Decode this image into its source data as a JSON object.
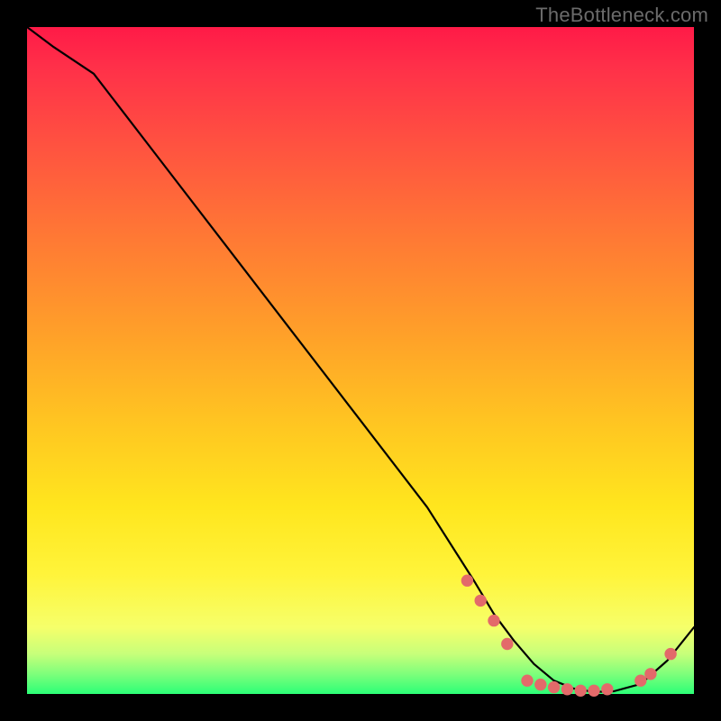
{
  "watermark": "TheBottleneck.com",
  "chart_data": {
    "type": "line",
    "title": "",
    "xlabel": "",
    "ylabel": "",
    "xlim": [
      0,
      100
    ],
    "ylim": [
      0,
      100
    ],
    "grid": false,
    "legend": false,
    "series": [
      {
        "name": "curve",
        "x": [
          0,
          4,
          10,
          20,
          30,
          40,
          50,
          60,
          67,
          70,
          73,
          76,
          79,
          82,
          85,
          88,
          92,
          96,
          100
        ],
        "y": [
          100,
          97,
          93,
          80,
          67,
          54,
          41,
          28,
          17,
          12,
          8,
          4.5,
          2,
          0.8,
          0.3,
          0.4,
          1.5,
          5,
          10
        ],
        "color": "#000000"
      }
    ],
    "markers": {
      "name": "highlight-points",
      "color": "#e36a6a",
      "radius_frac": 0.009,
      "points": [
        {
          "x": 66,
          "y": 17
        },
        {
          "x": 68,
          "y": 14
        },
        {
          "x": 70,
          "y": 11
        },
        {
          "x": 72,
          "y": 7.5
        },
        {
          "x": 75,
          "y": 2.0
        },
        {
          "x": 77,
          "y": 1.4
        },
        {
          "x": 79,
          "y": 1.0
        },
        {
          "x": 81,
          "y": 0.7
        },
        {
          "x": 83,
          "y": 0.5
        },
        {
          "x": 85,
          "y": 0.5
        },
        {
          "x": 87,
          "y": 0.7
        },
        {
          "x": 92,
          "y": 2.0
        },
        {
          "x": 93.5,
          "y": 3.0
        },
        {
          "x": 96.5,
          "y": 6.0
        }
      ]
    },
    "background_gradient": {
      "type": "vertical",
      "stops": [
        {
          "pos": 0.0,
          "color": "#ff1a47"
        },
        {
          "pos": 0.5,
          "color": "#ffc721"
        },
        {
          "pos": 0.85,
          "color": "#fff43a"
        },
        {
          "pos": 1.0,
          "color": "#2cff77"
        }
      ]
    }
  }
}
